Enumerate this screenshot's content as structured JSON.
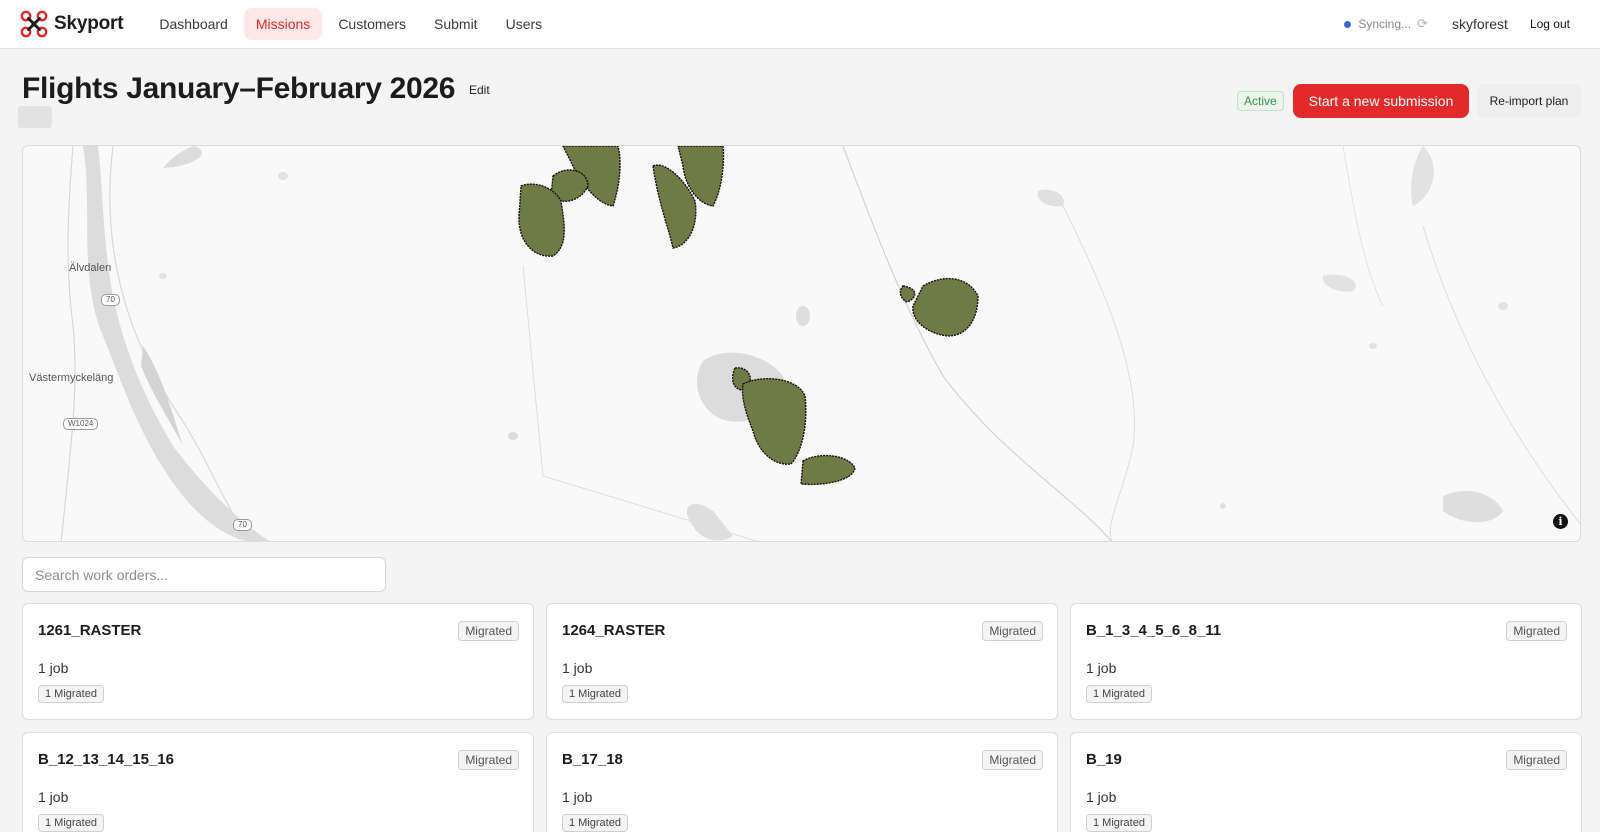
{
  "header": {
    "brand": "Skyport",
    "nav": [
      {
        "label": "Dashboard",
        "active": false
      },
      {
        "label": "Missions",
        "active": true
      },
      {
        "label": "Customers",
        "active": false
      },
      {
        "label": "Submit",
        "active": false
      },
      {
        "label": "Users",
        "active": false
      }
    ],
    "sync_status": "Syncing...",
    "username": "skyforest",
    "logout": "Log out",
    "accent_color": "#e32a2a",
    "sync_dot_color": "#3568e0"
  },
  "page": {
    "title": "Flights January–February 2026",
    "edit": "Edit",
    "status": "Active",
    "primary_action": "Start a new submission",
    "secondary_action": "Re-import plan"
  },
  "map": {
    "places": [
      "Älvdalen",
      "Västermyckeläng"
    ],
    "road_shields": [
      "70",
      "W1024",
      "70"
    ],
    "info_icon": "info-icon",
    "polygon_fill": "#6f7a45"
  },
  "search": {
    "placeholder": "Search work orders..."
  },
  "work_orders": [
    {
      "name": "1261_RASTER",
      "badge": "Migrated",
      "jobs": "1 job",
      "migrated": "1 Migrated"
    },
    {
      "name": "1264_RASTER",
      "badge": "Migrated",
      "jobs": "1 job",
      "migrated": "1 Migrated"
    },
    {
      "name": "B_1_3_4_5_6_8_11",
      "badge": "Migrated",
      "jobs": "1 job",
      "migrated": "1 Migrated"
    },
    {
      "name": "B_12_13_14_15_16",
      "badge": "Migrated",
      "jobs": "1 job",
      "migrated": "1 Migrated"
    },
    {
      "name": "B_17_18",
      "badge": "Migrated",
      "jobs": "1 job",
      "migrated": "1 Migrated"
    },
    {
      "name": "B_19",
      "badge": "Migrated",
      "jobs": "1 job",
      "migrated": "1 Migrated"
    }
  ]
}
